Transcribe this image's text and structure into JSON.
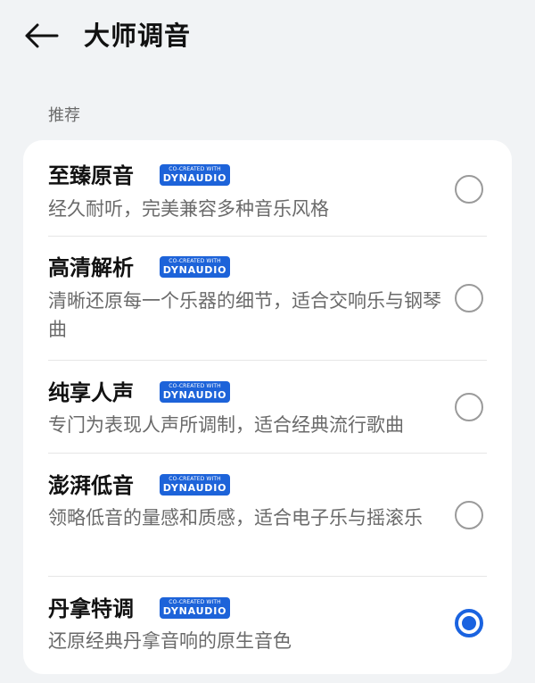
{
  "header": {
    "title": "大师调音",
    "back_icon": "arrow-left-icon"
  },
  "section": {
    "label": "推荐"
  },
  "badge": {
    "line1": "CO-CREATED WITH",
    "line2": "DYNAUDIO",
    "color": "#1d63d9"
  },
  "accent_color": "#1a63e0",
  "options": [
    {
      "title": "至臻原音",
      "desc": "经久耐听，完美兼容多种音乐风格",
      "selected": false
    },
    {
      "title": "高清解析",
      "desc": "清晰还原每一个乐器的细节，适合交响乐与钢琴曲",
      "selected": false
    },
    {
      "title": "纯享人声",
      "desc": "专门为表现人声所调制，适合经典流行歌曲",
      "selected": false
    },
    {
      "title": "澎湃低音",
      "desc": "领略低音的量感和质感，适合电子乐与摇滚乐",
      "selected": false
    },
    {
      "title": "丹拿特调",
      "desc": "还原经典丹拿音响的原生音色",
      "selected": true
    }
  ]
}
